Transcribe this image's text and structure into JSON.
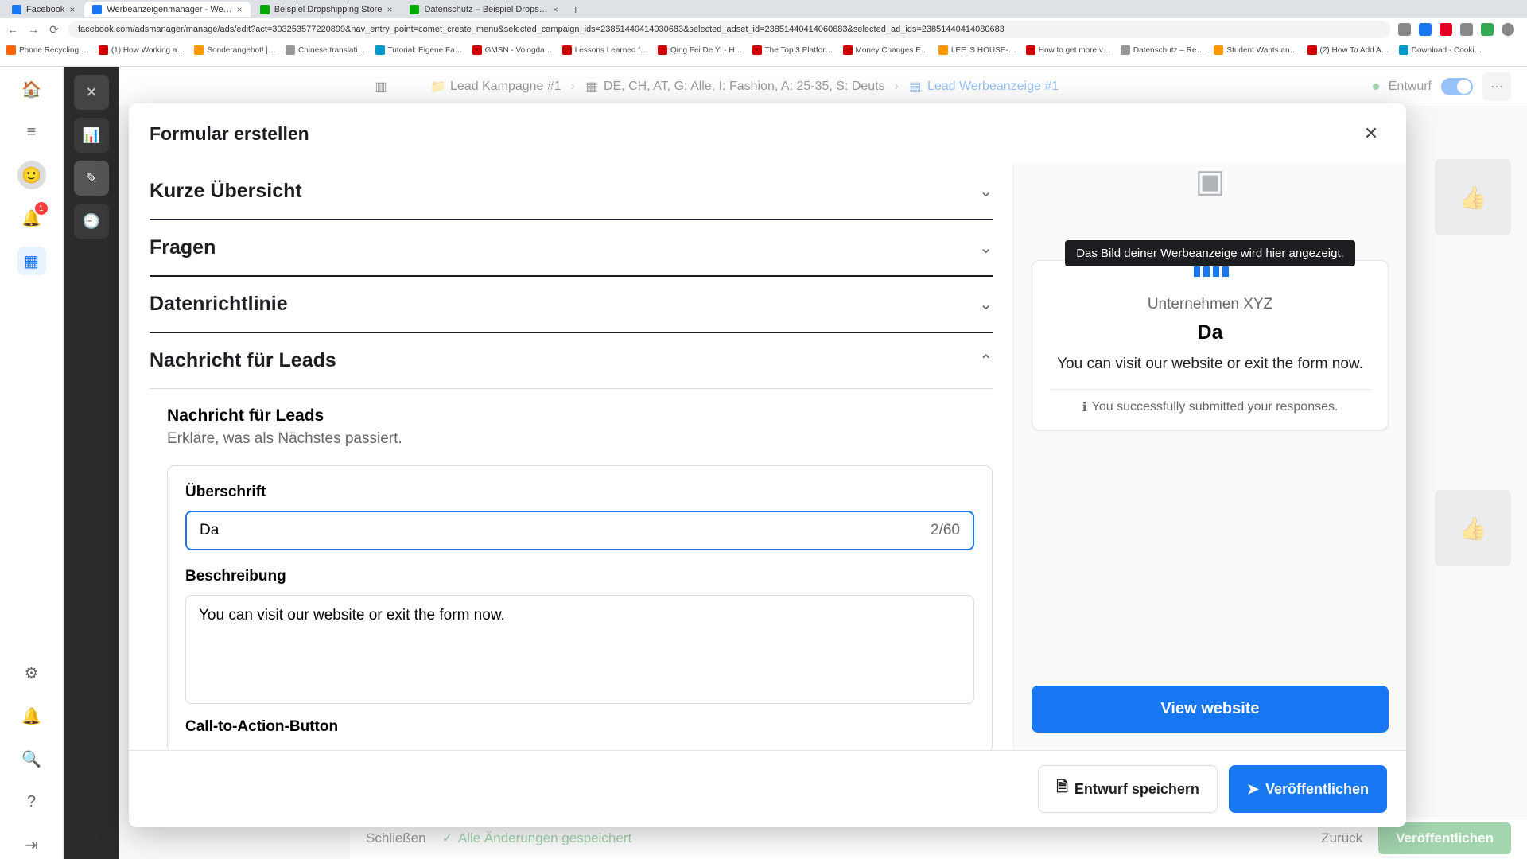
{
  "browser": {
    "tabs": [
      {
        "label": "Facebook"
      },
      {
        "label": "Werbeanzeigenmanager - We…"
      },
      {
        "label": "Beispiel Dropshipping Store"
      },
      {
        "label": "Datenschutz – Beispiel Drops…"
      }
    ],
    "url": "facebook.com/adsmanager/manage/ads/edit?act=303253577220899&nav_entry_point=comet_create_menu&selected_campaign_ids=23851440414030683&selected_adset_id=23851440414060683&selected_ad_ids=23851440414080683",
    "bookmarks": [
      "Phone Recycling …",
      "(1) How Working a…",
      "Sonderangebot! |…",
      "Chinese translati…",
      "Tutorial: Eigene Fa…",
      "GMSN - Vologda…",
      "Lessons Learned f…",
      "Qing Fei De Yi - H…",
      "The Top 3 Platfor…",
      "Money Changes E…",
      "LEE 'S HOUSE-…",
      "How to get more v…",
      "Datenschutz – Re…",
      "Student Wants an…",
      "(2) How To Add A…",
      "Download - Cooki…"
    ]
  },
  "header": {
    "campaign": "Lead Kampagne #1",
    "adset": "DE, CH, AT, G: Alle, I: Fashion, A: 25-35, S: Deuts",
    "ad": "Lead Werbeanzeige #1",
    "status": "Entwurf"
  },
  "left_rail_badge": "1",
  "bottom": {
    "close": "Schließen",
    "saved": "Alle Änderungen gespeichert",
    "back": "Zurück",
    "publish": "Veröffentlichen"
  },
  "modal": {
    "title": "Formular erstellen",
    "sections": {
      "overview": "Kurze Übersicht",
      "questions": "Fragen",
      "privacy": "Datenrichtlinie",
      "completion": "Nachricht für Leads"
    },
    "completion": {
      "sub_title": "Nachricht für Leads",
      "sub_desc": "Erkläre, was als Nächstes passiert.",
      "headline_label": "Überschrift",
      "headline_value": "Da",
      "headline_count": "2/60",
      "description_label": "Beschreibung",
      "description_value": "You can visit our website or exit the form now.",
      "cta_label": "Call-to-Action-Button"
    },
    "footer": {
      "save_draft": "Entwurf speichern",
      "publish": "Veröffentlichen"
    }
  },
  "preview": {
    "tooltip": "Das Bild deiner Werbeanzeige wird hier angezeigt.",
    "company": "Unternehmen XYZ",
    "headline": "Da",
    "desc": "You can visit our website or exit the form now.",
    "submitted": "You successfully submitted your responses.",
    "cta": "View website"
  }
}
